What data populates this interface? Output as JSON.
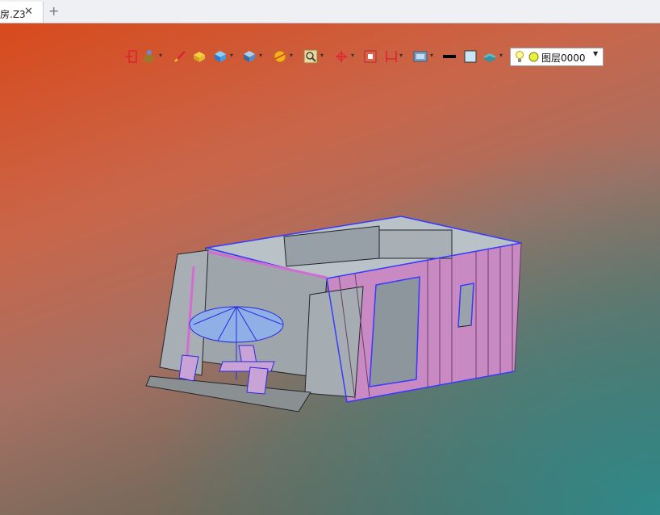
{
  "tabs": [
    {
      "title": "房.Z3"
    }
  ],
  "tab_bar": {
    "close_icon": "close-icon",
    "add_icon": "plus-icon"
  },
  "toolbar": {
    "tools": [
      "exit-sketch-icon",
      "paint-can-icon",
      "pencil-icon",
      "cube-solid-icon",
      "box-shaded-icon",
      "view-cube-icon",
      "section-icon",
      "zoom-icon",
      "axis-icon",
      "stop-icon",
      "dimension-icon",
      "display-mode-icon",
      "line-color-icon",
      "fill-color-icon",
      "layer-manager-icon"
    ],
    "layer": {
      "label": "图层0000",
      "icons": [
        "bulb-icon",
        "layer-color-icon"
      ]
    }
  },
  "colors": {
    "tab_active": "#ffffff",
    "wire_blue": "#3a3aff",
    "wire_pink": "#d36bd3"
  }
}
